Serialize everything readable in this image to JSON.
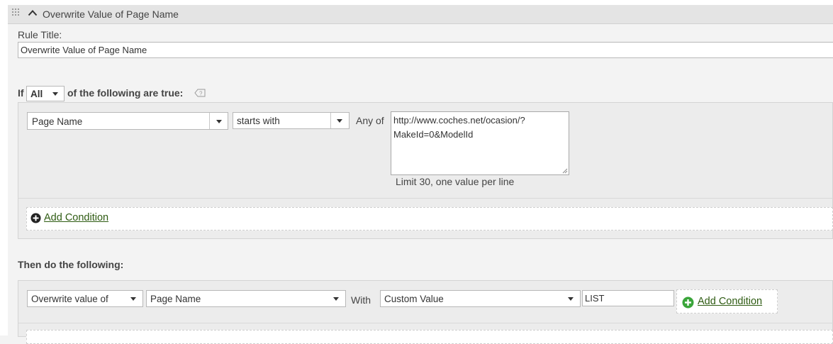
{
  "panel": {
    "title": "Overwrite Value of Page Name"
  },
  "rule": {
    "title_label": "Rule Title:",
    "title_value": "Overwrite Value of Page Name"
  },
  "conditions": {
    "if_label": "If",
    "match_select": "All",
    "following_label": "of the following are true:",
    "row": {
      "field_select": "Page Name",
      "operator_select": "starts with",
      "any_of_label": "Any of",
      "values_text": "http://www.coches.net/ocasion/?\nMakeId=0&ModelId",
      "limit_hint": "Limit 30, one value per line"
    },
    "add_condition_label": "Add Condition"
  },
  "actions": {
    "then_label": "Then do the following:",
    "action_select": "Overwrite value of",
    "target_select": "Page Name",
    "with_label": "With",
    "value_type_select": "Custom Value",
    "custom_value": "LIST",
    "add_condition_label": "Add Condition"
  },
  "colors": {
    "link_green": "#2e5b12",
    "add_icon_green": "#3aa53a",
    "header_bg": "#e4e4e4"
  },
  "icons": [
    "grip-icon",
    "chevron-up-icon",
    "help-icon",
    "add-circle-icon",
    "add-circle-green-icon",
    "dropdown-arrow-icon",
    "resize-grip-icon"
  ]
}
